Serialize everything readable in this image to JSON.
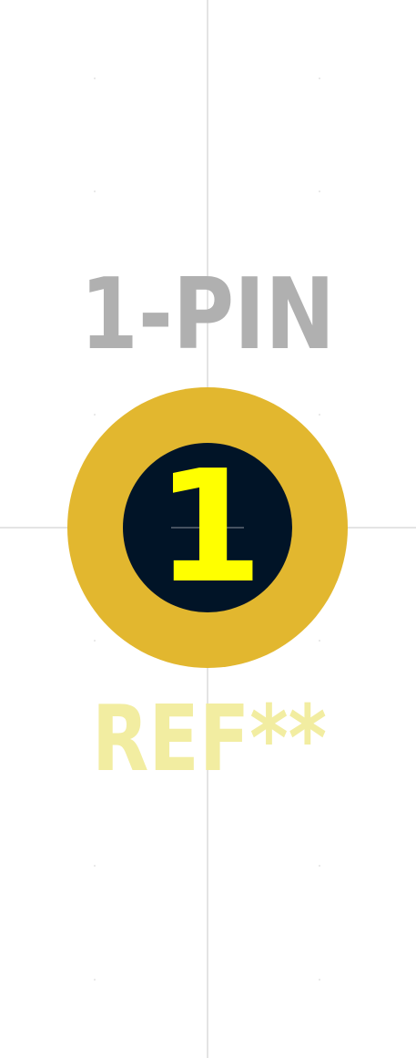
{
  "footprint": {
    "value_label": "1-PIN",
    "reference_label": "REF**",
    "pad": {
      "number": "1"
    }
  },
  "colors": {
    "background": "#ffffff",
    "crosshair": "#c8c8c8",
    "grid_dot": "#d0d0d0",
    "fab_text": "#b0b0b0",
    "silk_text": "#f2eda1",
    "pad_copper": "#e2b72f",
    "drill_hole": "#011427",
    "pad_number": "#ffff00"
  }
}
